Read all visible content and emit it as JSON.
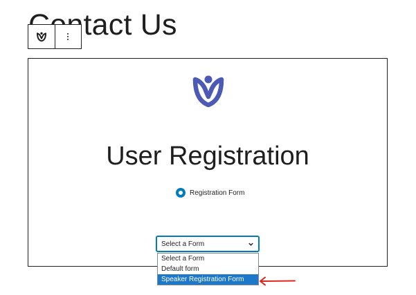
{
  "page": {
    "title": "Contact Us"
  },
  "toolbar": {
    "block_icon": "user-registration-logo-icon",
    "more_icon": "more-vertical-icon"
  },
  "block": {
    "logo_icon": "user-registration-logo-icon",
    "heading": "User Registration",
    "radio_label": "Registration Form"
  },
  "select": {
    "value": "Select a Form",
    "options": [
      "Select a Form",
      "Default form",
      "Speaker Registration Form"
    ],
    "highlighted": "Speaker Registration Form"
  },
  "colors": {
    "logo": "#4c5ab5",
    "radio": "#007cba",
    "highlight": "#1e78c8",
    "arrow": "#e1251b"
  }
}
